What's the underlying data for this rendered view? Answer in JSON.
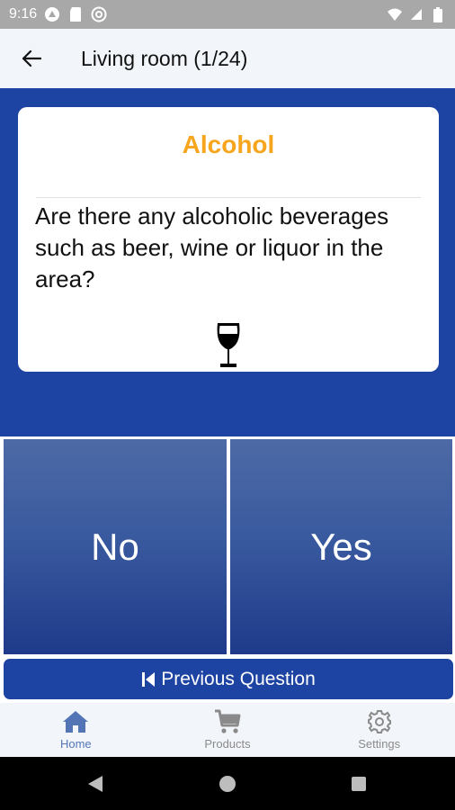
{
  "status_bar": {
    "time": "9:16"
  },
  "app_bar": {
    "title": "Living room (1/24)"
  },
  "card": {
    "title": "Alcohol",
    "question": "Are there any alcoholic beverages such as beer, wine or liquor in the area?",
    "icon": "wine-glass-icon"
  },
  "answers": {
    "no_label": "No",
    "yes_label": "Yes"
  },
  "previous_button": {
    "label": "Previous Question",
    "icon": "step-back-icon"
  },
  "bottom_nav": {
    "items": [
      {
        "label": "Home",
        "icon": "home-icon",
        "active": true
      },
      {
        "label": "Products",
        "icon": "cart-icon",
        "active": false
      },
      {
        "label": "Settings",
        "icon": "gear-icon",
        "active": false
      }
    ]
  },
  "colors": {
    "primary": "#1d43a3",
    "accent": "#f6a51c",
    "nav_active": "#5375b5",
    "nav_inactive": "#8a8a8a"
  }
}
